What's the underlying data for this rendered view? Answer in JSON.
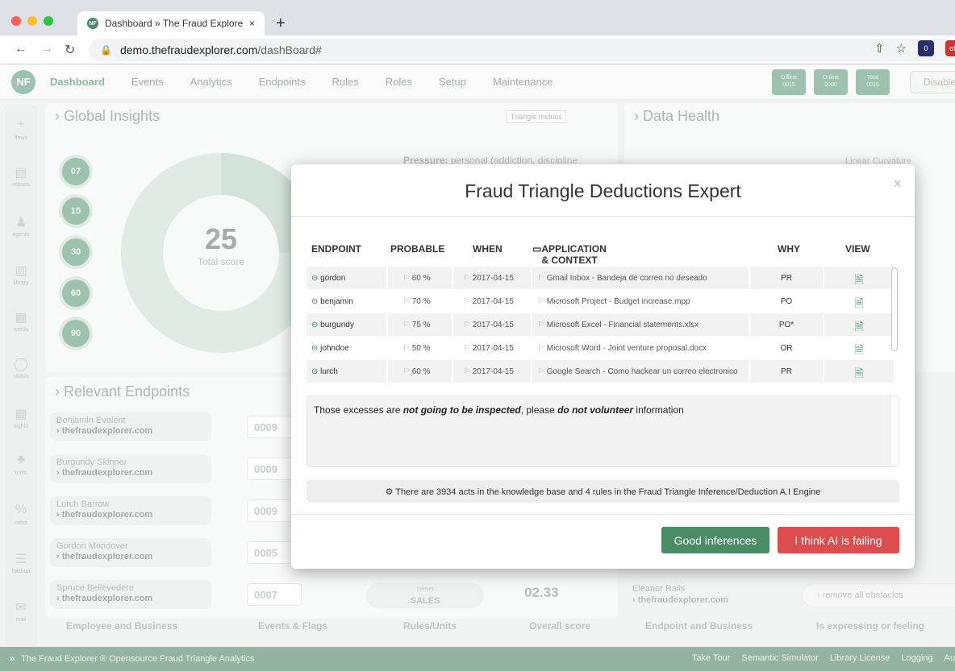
{
  "browser": {
    "tab_title": "Dashboard » The Fraud Explore",
    "tab_favicon": "NF",
    "tab_close": "×",
    "new_tab": "+",
    "url_host": "demo.thefraudexplorer.com",
    "url_path": "/dashBoard#",
    "ext1": "0",
    "ext2": "off"
  },
  "nav": {
    "logo": "NF",
    "items": [
      "Dashboard",
      "Events",
      "Analytics",
      "Endpoints",
      "Rules",
      "Roles",
      "Setup",
      "Maintenance"
    ],
    "counters": [
      {
        "label": "Offline",
        "value": "0015"
      },
      {
        "label": "Online",
        "value": "0000"
      },
      {
        "label": "Total",
        "value": "0015"
      }
    ],
    "disable": "Disable"
  },
  "sidebar": [
    "flows",
    "reports",
    "agents",
    "library",
    "words",
    "status",
    "sights",
    "units",
    "robot",
    "backup",
    "mail"
  ],
  "global": {
    "title": "Global Insights",
    "metrics_btn": "Triangle metrics",
    "bubbles": [
      "07",
      "15",
      "30",
      "60",
      "90"
    ],
    "score": "25",
    "score_label": "Total score",
    "pressure": "Pressure:",
    "pressure_text": "personal (addiction, discipline"
  },
  "health": {
    "title": "Data Health",
    "legend": "Linear Curvature"
  },
  "relevant": {
    "title": "Relevant Endpoints",
    "rows": [
      {
        "name": "Benjamin Evalent",
        "domain": "thefraudexplorer.com",
        "score": "0009"
      },
      {
        "name": "Burgundy Skinner",
        "domain": "thefraudexplorer.com",
        "score": "0009"
      },
      {
        "name": "Lurch Barrow",
        "domain": "thefraudexplorer.com",
        "score": "0009"
      },
      {
        "name": "Gordon Mondover",
        "domain": "thefraudexplorer.com",
        "score": "0005"
      },
      {
        "name": "Spruce Bellevedere",
        "domain": "thefraudexplorer.com",
        "score": "0007"
      }
    ],
    "ruleset_label": "ruleset",
    "ruleset": "SALES",
    "value": "02.33",
    "right_name": "Eleanor Rails",
    "right_domain": "thefraudexplorer.com",
    "remove": "remove all obstacles"
  },
  "bottom": [
    "Employee and Business",
    "Events & Flags",
    "Rules/Units",
    "Overall score",
    "Endpoint and Business",
    "Is expressing or feeling"
  ],
  "footer": {
    "left": "The Fraud Explorer ® Opensource Fraud Triangle Analytics",
    "right": [
      "Take Tour",
      "Semantic Simulator",
      "Library License",
      "Logging",
      "Au"
    ]
  },
  "modal": {
    "title": "Fraud Triangle Deductions Expert",
    "close": "×",
    "headers": [
      "ENDPOINT",
      "PROBABLE",
      "WHEN",
      "APPLICATION & CONTEXT",
      "WHY",
      "VIEW"
    ],
    "rows": [
      {
        "endpoint": "gordon",
        "probable": "60 %",
        "when": "2017-04-15",
        "app": "Gmail Inbox - Bandeja de correo no deseado",
        "why": "PR"
      },
      {
        "endpoint": "benjamin",
        "probable": "70 %",
        "when": "2017-04-15",
        "app": "Microsoft Project - Budget increase.mpp",
        "why": "PO"
      },
      {
        "endpoint": "burgundy",
        "probable": "75 %",
        "when": "2017-04-15",
        "app": "Microsoft Excel - Financial statements.xlsx",
        "why": "PO*"
      },
      {
        "endpoint": "johndoe",
        "probable": "50 %",
        "when": "2017-04-15",
        "app": "Microsoft Word - Joint venture proposal.docx",
        "why": "OR"
      },
      {
        "endpoint": "lurch",
        "probable": "60 %",
        "when": "2017-04-15",
        "app": "Google Search - Como hackear un correo electronico",
        "why": "PR"
      }
    ],
    "msg_a": "Those excesses are ",
    "msg_b": "not going to be inspected",
    "msg_c": ", please ",
    "msg_d": "do not volunteer",
    "msg_e": " information",
    "kb": "There are 3934 acts in the knowledge base and 4 rules in the Fraud Triangle Inference/Deduction A.I Engine",
    "good": "Good inferences",
    "bad": "I think AI is failing",
    "good_color": "#4a8c64",
    "bad_color": "#dc4e4e"
  }
}
